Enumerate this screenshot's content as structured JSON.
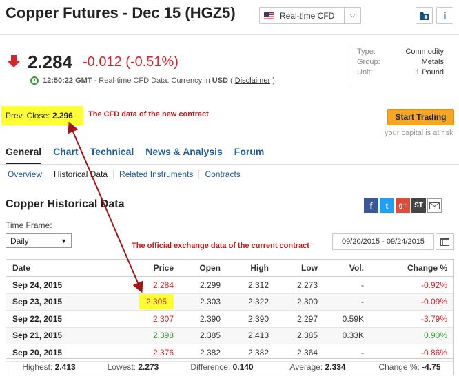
{
  "header": {
    "title": "Copper Futures - Dec 15 (HGZ5)",
    "cfd_label": "Real-time CFD"
  },
  "quote": {
    "price": "2.284",
    "change": "-0.012",
    "change_pct": "(-0.51%)",
    "time": "12:50:22 GMT",
    "time_note": " - Real-time CFD Data. Currency in ",
    "currency": "USD",
    "paren_open": "(",
    "disclaimer": "Disclaimer",
    "paren_close": ")"
  },
  "info": [
    {
      "key": "Type:",
      "value": "Commodity"
    },
    {
      "key": "Group:",
      "value": "Metals"
    },
    {
      "key": "Unit:",
      "value": "1 Pound"
    }
  ],
  "prev_close": {
    "label": "Prev. Close: ",
    "value": "2.296"
  },
  "annotations": {
    "cfd_note": "The CFD data of the new contract",
    "exchange_note": "The official exchange data of the current contract"
  },
  "trade": {
    "button": "Start Trading",
    "risk": "your capital is at risk"
  },
  "tabs": [
    "General",
    "Chart",
    "Technical",
    "News & Analysis",
    "Forum"
  ],
  "subtabs": [
    "Overview",
    "Historical Data",
    "Related Instruments",
    "Contracts"
  ],
  "section_title": "Copper Historical Data",
  "timeframe": {
    "label": "Time Frame:",
    "value": "Daily"
  },
  "date_range": "09/20/2015 - 09/24/2015",
  "table": {
    "headers": [
      "Date",
      "Price",
      "Open",
      "High",
      "Low",
      "Vol.",
      "Change %"
    ],
    "rows": [
      [
        "Sep 24, 2015",
        "2.284",
        "2.299",
        "2.312",
        "2.273",
        "-",
        "-0.92%"
      ],
      [
        "Sep 23, 2015",
        "2.305",
        "2.303",
        "2.322",
        "2.300",
        "-",
        "-0.09%"
      ],
      [
        "Sep 22, 2015",
        "2.307",
        "2.390",
        "2.390",
        "2.297",
        "0.59K",
        "-3.79%"
      ],
      [
        "Sep 21, 2015",
        "2.398",
        "2.385",
        "2.413",
        "2.385",
        "0.33K",
        "0.90%"
      ],
      [
        "Sep 20, 2015",
        "2.376",
        "2.382",
        "2.382",
        "2.364",
        "-",
        "-0.86%"
      ]
    ]
  },
  "summary": {
    "highest_label": "Highest: ",
    "highest": "2.413",
    "lowest_label": "Lowest: ",
    "lowest": "2.273",
    "difference_label": "Difference: ",
    "difference": "0.140",
    "average_label": "Average: ",
    "average": "2.334",
    "change_label": "Change %: ",
    "change": "-4.75"
  },
  "colors": {
    "accent": "#1a5d9a",
    "negative": "#d8232a",
    "positive": "#3a9b3a",
    "highlight": "#ffff32",
    "button": "#f5a623"
  }
}
